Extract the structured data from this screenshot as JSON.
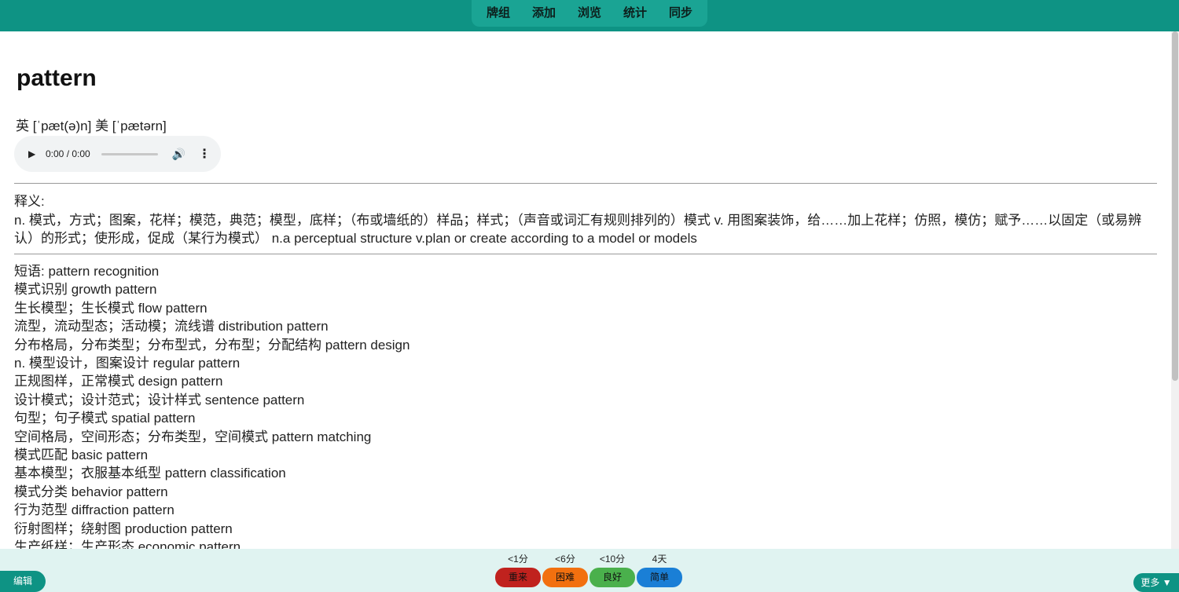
{
  "nav": {
    "items": [
      "牌组",
      "添加",
      "浏览",
      "统计",
      "同步"
    ]
  },
  "card": {
    "word": "pattern",
    "phonetic": "英 [ˈpæt(ə)n] 美 [ˈpætərn]",
    "audio": {
      "time": "0:00 / 0:00",
      "play_icon": "play-icon",
      "volume_icon": "volume-icon",
      "menu_icon": "more-vertical-icon"
    },
    "meaning_label": "释义:",
    "meaning_text": "n. 模式，方式；图案，花样；模范，典范；模型，底样；（布或墙纸的）样品；样式；（声音或词汇有规则排列的）模式 v. 用图案装饰，给……加上花样；仿照，模仿；赋予……以固定（或易辨认）的形式；使形成，促成（某行为模式） n.a perceptual structure v.plan or create according to a model or models",
    "phrases_label": "短语:",
    "phrase_lines": [
      "短语:  pattern recognition",
      "模式识别 growth pattern",
      "生长模型；生长模式 flow pattern",
      "流型，流动型态；活动模；流线谱 distribution pattern",
      "分布格局，分布类型；分布型式，分布型；分配结构 pattern design",
      "n. 模型设计，图案设计 regular pattern",
      "正规图样，正常模式 design pattern",
      "设计模式；设计范式；设计样式 sentence pattern",
      "句型；句子模式 spatial pattern",
      "空间格局，空间形态；分布类型，空间模式 pattern matching",
      "模式匹配 basic pattern",
      "基本模型；衣服基本纸型 pattern classification",
      "模式分类 behavior pattern",
      "行为范型 diffraction pattern",
      "衍射图样；绕射图 production pattern",
      "生产纸样；生产形态 economic pattern"
    ]
  },
  "bottom": {
    "edit_label": "编辑",
    "more_label": "更多 ▼",
    "answers": [
      {
        "interval": "<1分",
        "label": "重来",
        "color": "#c0221e"
      },
      {
        "interval": "<6分",
        "label": "困难",
        "color": "#f2700f"
      },
      {
        "interval": "<10分",
        "label": "良好",
        "color": "#4ab04c"
      },
      {
        "interval": "4天",
        "label": "简单",
        "color": "#1a7fd6"
      }
    ]
  },
  "colors": {
    "accent": "#0e9384",
    "bottom_bg": "#e0f3f1"
  }
}
